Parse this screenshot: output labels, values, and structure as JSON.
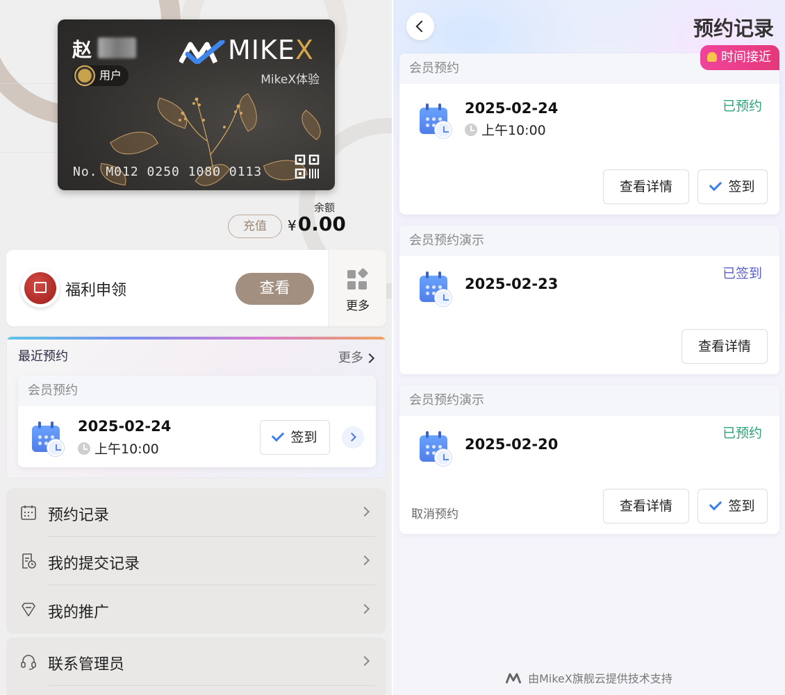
{
  "member_page": {
    "card": {
      "name": "赵",
      "role_badge": "用户",
      "brand": "MIKE",
      "brand_x": "X",
      "subtitle": "MikeX体验",
      "card_number": "No. M012 0250 1080 0113"
    },
    "balance": {
      "label": "余额",
      "currency": "¥",
      "amount": "0.00",
      "recharge_label": "充值"
    },
    "benefit": {
      "title": "福利申领",
      "view_label": "查看",
      "more_label": "更多"
    },
    "recent": {
      "title": "最近预约",
      "more_label": "更多",
      "item": {
        "category": "会员预约",
        "date": "2025-02-24",
        "time": "上午10:00",
        "checkin_label": "签到"
      }
    },
    "menu": [
      {
        "label": "预约记录",
        "icon": "calendar-icon"
      },
      {
        "label": "我的提交记录",
        "icon": "document-clock-icon"
      },
      {
        "label": "我的推广",
        "icon": "promotion-icon"
      }
    ],
    "menu2": [
      {
        "label": "联系管理员",
        "icon": "headset-icon"
      }
    ]
  },
  "records_page": {
    "title": "预约记录",
    "soon_tag": "时间接近",
    "records": [
      {
        "category": "会员预约",
        "date": "2025-02-24",
        "time": "上午10:00",
        "status": "已预约",
        "status_color": "#2aa37a",
        "detail_label": "查看详情",
        "checkin_label": "签到"
      },
      {
        "category": "会员预约演示",
        "date": "2025-02-23",
        "status": "已签到",
        "status_color": "#5b5fc7",
        "detail_label": "查看详情"
      },
      {
        "category": "会员预约演示",
        "date": "2025-02-20",
        "status": "已预约",
        "status_color": "#2aa37a",
        "detail_label": "查看详情",
        "checkin_label": "签到",
        "cancel_label": "取消预约"
      }
    ],
    "footer": "由MikeX旗舰云提供技术支持"
  }
}
